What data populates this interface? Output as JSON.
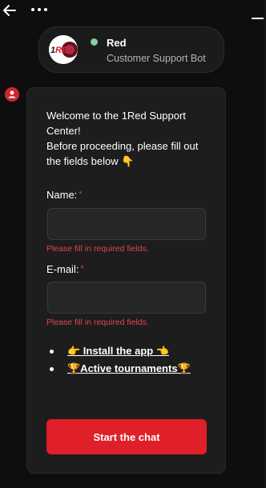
{
  "top_bar": {
    "back_icon": "arrow-left-icon",
    "more_icon": "more-horizontal-icon",
    "minimize_icon": "minimize-icon"
  },
  "header": {
    "logo_text": "1RED",
    "bot_name": "Red",
    "bot_role": "Customer Support Bot",
    "status_color": "#7fd1a2"
  },
  "message": {
    "welcome_line1": "Welcome to the 1Red Support Center!",
    "welcome_line2": "Before proceeding, please fill out the fields below 👇",
    "name_label": "Name:",
    "name_required": "*",
    "name_value": "",
    "name_error": "Please fill in required fields.",
    "email_label": "E-mail:",
    "email_required": "*",
    "email_value": "",
    "email_error": "Please fill in required fields.",
    "links": [
      {
        "label": "👉 Install the app 👈"
      },
      {
        "label": "🏆Active tournaments🏆"
      }
    ],
    "start_button": "Start the chat"
  },
  "colors": {
    "accent": "#e02028",
    "error": "#e0464d",
    "card_bg": "#1d1d1d",
    "page_bg": "#0e0e0e"
  }
}
